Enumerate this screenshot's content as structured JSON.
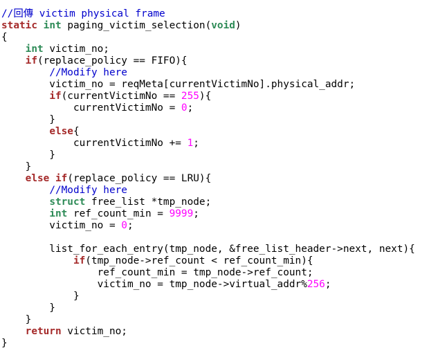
{
  "colors": {
    "background": "#ffffff",
    "plain": "#000000",
    "comment": "#0000cc",
    "keyword": "#a52a2a",
    "type": "#2e8b57",
    "number": "#ff00ff"
  },
  "code": {
    "lines": [
      [
        {
          "t": "comment",
          "v": "//回傳 victim physical frame"
        }
      ],
      [
        {
          "t": "keyword",
          "v": "static"
        },
        {
          "t": "plain",
          "v": " "
        },
        {
          "t": "type",
          "v": "int"
        },
        {
          "t": "plain",
          "v": " paging_victim_selection("
        },
        {
          "t": "type",
          "v": "void"
        },
        {
          "t": "plain",
          "v": ")"
        }
      ],
      [
        {
          "t": "plain",
          "v": "{"
        }
      ],
      [
        {
          "t": "plain",
          "v": "    "
        },
        {
          "t": "type",
          "v": "int"
        },
        {
          "t": "plain",
          "v": " victim_no;"
        }
      ],
      [
        {
          "t": "plain",
          "v": "    "
        },
        {
          "t": "keyword",
          "v": "if"
        },
        {
          "t": "plain",
          "v": "(replace_policy == FIFO){"
        }
      ],
      [
        {
          "t": "plain",
          "v": "        "
        },
        {
          "t": "comment",
          "v": "//Modify here"
        }
      ],
      [
        {
          "t": "plain",
          "v": "        victim_no = reqMeta[currentVictimNo].physical_addr;"
        }
      ],
      [
        {
          "t": "plain",
          "v": "        "
        },
        {
          "t": "keyword",
          "v": "if"
        },
        {
          "t": "plain",
          "v": "(currentVictimNo == "
        },
        {
          "t": "number",
          "v": "255"
        },
        {
          "t": "plain",
          "v": "){"
        }
      ],
      [
        {
          "t": "plain",
          "v": "            currentVictimNo = "
        },
        {
          "t": "number",
          "v": "0"
        },
        {
          "t": "plain",
          "v": ";"
        }
      ],
      [
        {
          "t": "plain",
          "v": "        }"
        }
      ],
      [
        {
          "t": "plain",
          "v": "        "
        },
        {
          "t": "keyword",
          "v": "else"
        },
        {
          "t": "plain",
          "v": "{"
        }
      ],
      [
        {
          "t": "plain",
          "v": "            currentVictimNo += "
        },
        {
          "t": "number",
          "v": "1"
        },
        {
          "t": "plain",
          "v": ";"
        }
      ],
      [
        {
          "t": "plain",
          "v": "        }"
        }
      ],
      [
        {
          "t": "plain",
          "v": "    }"
        }
      ],
      [
        {
          "t": "plain",
          "v": "    "
        },
        {
          "t": "keyword",
          "v": "else"
        },
        {
          "t": "plain",
          "v": " "
        },
        {
          "t": "keyword",
          "v": "if"
        },
        {
          "t": "plain",
          "v": "(replace_policy == LRU){"
        }
      ],
      [
        {
          "t": "plain",
          "v": "        "
        },
        {
          "t": "comment",
          "v": "//Modify here"
        }
      ],
      [
        {
          "t": "plain",
          "v": "        "
        },
        {
          "t": "type",
          "v": "struct"
        },
        {
          "t": "plain",
          "v": " free_list *tmp_node;"
        }
      ],
      [
        {
          "t": "plain",
          "v": "        "
        },
        {
          "t": "type",
          "v": "int"
        },
        {
          "t": "plain",
          "v": " ref_count_min = "
        },
        {
          "t": "number",
          "v": "9999"
        },
        {
          "t": "plain",
          "v": ";"
        }
      ],
      [
        {
          "t": "plain",
          "v": "        victim_no = "
        },
        {
          "t": "number",
          "v": "0"
        },
        {
          "t": "plain",
          "v": ";"
        }
      ],
      [
        {
          "t": "plain",
          "v": ""
        }
      ],
      [
        {
          "t": "plain",
          "v": "        list_for_each_entry(tmp_node, &free_list_header->next, next){"
        }
      ],
      [
        {
          "t": "plain",
          "v": "            "
        },
        {
          "t": "keyword",
          "v": "if"
        },
        {
          "t": "plain",
          "v": "(tmp_node->ref_count < ref_count_min){"
        }
      ],
      [
        {
          "t": "plain",
          "v": "                ref_count_min = tmp_node->ref_count;"
        }
      ],
      [
        {
          "t": "plain",
          "v": "                victim_no = tmp_node->virtual_addr%"
        },
        {
          "t": "number",
          "v": "256"
        },
        {
          "t": "plain",
          "v": ";"
        }
      ],
      [
        {
          "t": "plain",
          "v": "            }"
        }
      ],
      [
        {
          "t": "plain",
          "v": "        }"
        }
      ],
      [
        {
          "t": "plain",
          "v": "    }"
        }
      ],
      [
        {
          "t": "plain",
          "v": "    "
        },
        {
          "t": "keyword",
          "v": "return"
        },
        {
          "t": "plain",
          "v": " victim_no;"
        }
      ],
      [
        {
          "t": "plain",
          "v": "}"
        }
      ]
    ]
  }
}
